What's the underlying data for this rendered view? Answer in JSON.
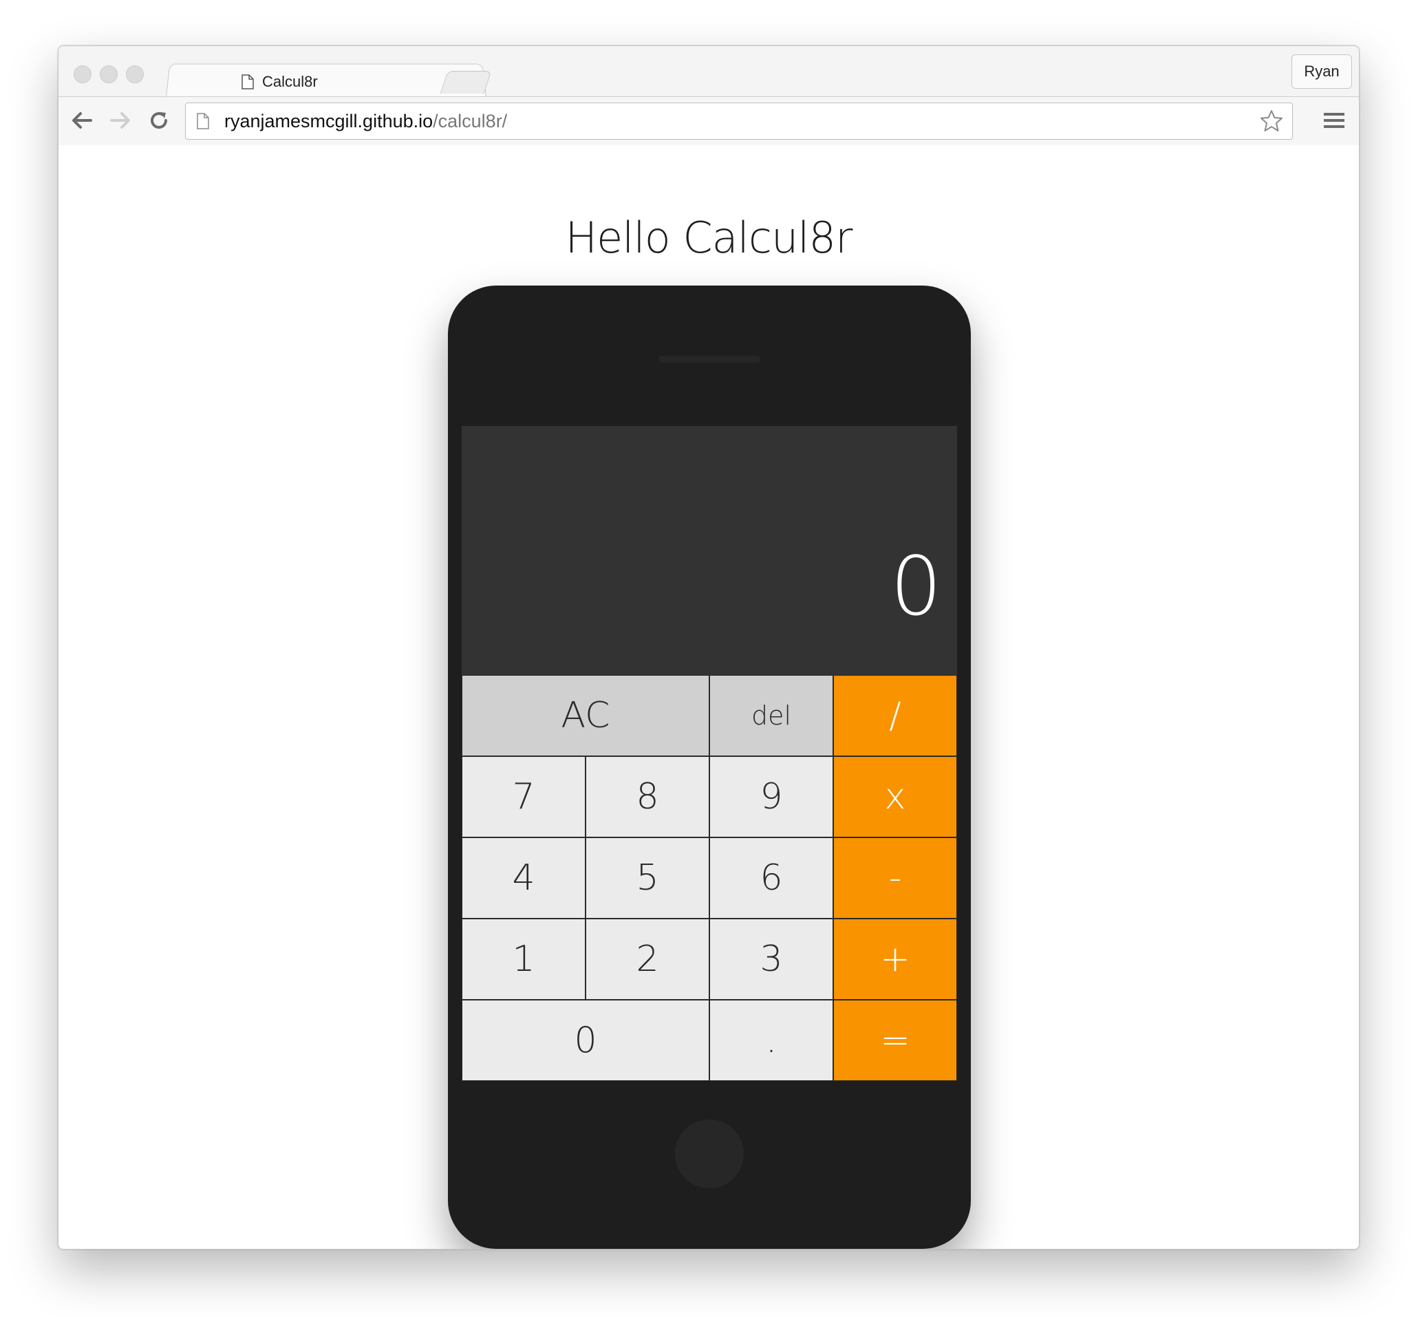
{
  "browser": {
    "tab": {
      "title": "Calcul8r",
      "close_glyph": "×"
    },
    "profile_label": "Ryan",
    "url": {
      "host": "ryanjamesmcgill.github.io",
      "path": "/calcul8r/"
    }
  },
  "page": {
    "heading": "Hello Calcul8r"
  },
  "calculator": {
    "display_value": "0",
    "keys": {
      "clear": "AC",
      "delete": "del",
      "divide": "/",
      "seven": "7",
      "eight": "8",
      "nine": "9",
      "multiply": "x",
      "four": "4",
      "five": "5",
      "six": "6",
      "subtract": "-",
      "one": "1",
      "two": "2",
      "three": "3",
      "add": "+",
      "zero": "0",
      "decimal": ".",
      "equals": "="
    },
    "colors": {
      "operator": "#f99300",
      "function_key": "#d0d0d0",
      "number_key": "#ebebeb",
      "display_bg": "#333333",
      "phone_body": "#1e1e1e"
    }
  },
  "icons": {
    "back": "arrow-left-icon",
    "forward": "arrow-right-icon",
    "reload": "reload-icon",
    "page": "page-icon",
    "bookmark": "star-icon",
    "menu": "hamburger-menu-icon"
  }
}
